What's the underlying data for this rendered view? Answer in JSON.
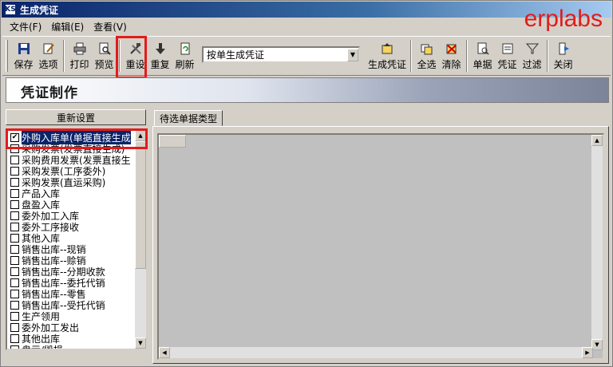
{
  "window": {
    "title": "生成凭证",
    "app_icon": "KS"
  },
  "watermark": "erplabs",
  "menu": [
    "文件(F)",
    "编辑(E)",
    "查看(V)"
  ],
  "toolbar": {
    "save": "保存",
    "options": "选项",
    "print": "打印",
    "preview": "预览",
    "reset": "重设",
    "repeat": "重复",
    "refresh": "刷新",
    "mode_select": "按单生成凭证",
    "generate": "生成凭证",
    "select_all": "全选",
    "clear": "清除",
    "doc": "单据",
    "voucher": "凭证",
    "filter": "过滤",
    "close": "关闭"
  },
  "banner_title": "凭证制作",
  "left": {
    "reset_button": "重新设置",
    "items": [
      {
        "label": "外购入库单(单据直接生成",
        "checked": true,
        "selected": true
      },
      {
        "label": "采购发票(发票直接生成)",
        "checked": false
      },
      {
        "label": "采购费用发票(发票直接生",
        "checked": false
      },
      {
        "label": "采购发票(工序委外)",
        "checked": false
      },
      {
        "label": "采购发票(直运采购)",
        "checked": false
      },
      {
        "label": "产品入库",
        "checked": false
      },
      {
        "label": "盘盈入库",
        "checked": false
      },
      {
        "label": "委外加工入库",
        "checked": false
      },
      {
        "label": "委外工序接收",
        "checked": false
      },
      {
        "label": "其他入库",
        "checked": false
      },
      {
        "label": "销售出库--现销",
        "checked": false
      },
      {
        "label": "销售出库--赊销",
        "checked": false
      },
      {
        "label": "销售出库--分期收款",
        "checked": false
      },
      {
        "label": "销售出库--委托代销",
        "checked": false
      },
      {
        "label": "销售出库--零售",
        "checked": false
      },
      {
        "label": "销售出库--受托代销",
        "checked": false
      },
      {
        "label": "生产领用",
        "checked": false
      },
      {
        "label": "委外加工发出",
        "checked": false
      },
      {
        "label": "其他出库",
        "checked": false
      },
      {
        "label": "盘亏/毁损",
        "checked": false
      }
    ]
  },
  "right": {
    "tab_label": "待选单据类型"
  }
}
